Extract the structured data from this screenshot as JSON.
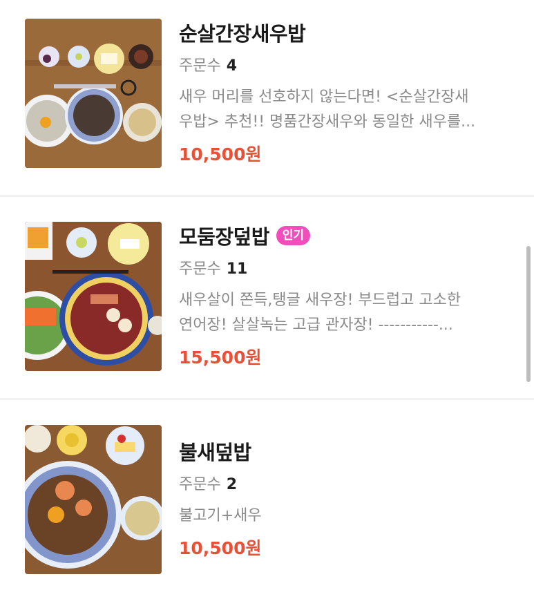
{
  "menu": [
    {
      "name": "순살간장새우밥",
      "badge": "",
      "orders_label": "주문수",
      "orders": "4",
      "desc_line1": "새우 머리를 선호하지 않는다면! <순살간장새",
      "desc_line2": "우밥> 추천!! 명품간장새우와 동일한 새우를...",
      "price": "10,500원"
    },
    {
      "name": "모둠장덮밥",
      "badge": "인기",
      "orders_label": "주문수",
      "orders": "11",
      "desc_line1": "새우살이 쫀득,탱글 새우장! 부드럽고 고소한",
      "desc_line2": "연어장! 살살녹는 고급 관자장! -----------...",
      "price": "15,500원"
    },
    {
      "name": "불새덮밥",
      "badge": "",
      "orders_label": "주문수",
      "orders": "2",
      "desc_line1": "불고기+새우",
      "desc_line2": "",
      "price": "10,500원"
    }
  ],
  "colors": {
    "price": "#e85138",
    "badge": "#f14dbb"
  }
}
